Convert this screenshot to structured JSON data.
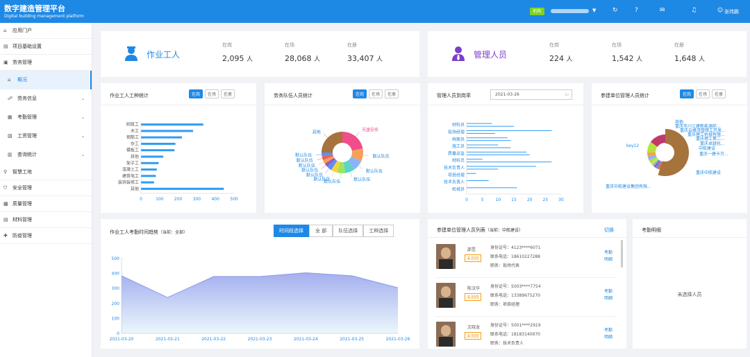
{
  "header": {
    "title": "数字建造管理平台",
    "subtitle": "Digital building management platform",
    "tag": "机构",
    "user": "张伟鹏",
    "icons": [
      "refresh-icon",
      "help-icon",
      "mail-icon",
      "bell-icon",
      "user-icon"
    ]
  },
  "sidebar": {
    "items": [
      {
        "label": "应用门户",
        "icon": "home-icon"
      },
      {
        "label": "项目基础设置",
        "icon": "settings-icon"
      },
      {
        "label": "劳务管理",
        "icon": "folder-icon"
      },
      {
        "label": "概况",
        "icon": "home-icon",
        "sub": true,
        "active": true
      },
      {
        "label": "劳务信息",
        "icon": "people-icon",
        "sub": true,
        "arrow": true
      },
      {
        "label": "考勤管理",
        "icon": "calendar-icon",
        "sub": true,
        "arrow": true
      },
      {
        "label": "工资管理",
        "icon": "wallet-icon",
        "sub": true,
        "arrow": true
      },
      {
        "label": "查询统计",
        "icon": "chart-icon",
        "sub": true,
        "arrow": true
      },
      {
        "label": "智慧工地",
        "icon": "pin-icon"
      },
      {
        "label": "安全管理",
        "icon": "shield-icon"
      },
      {
        "label": "质量管理",
        "icon": "check-icon"
      },
      {
        "label": "材料管理",
        "icon": "box-icon"
      },
      {
        "label": "防疫管理",
        "icon": "medical-icon"
      }
    ]
  },
  "workers": {
    "title": "作业工人",
    "stats": [
      {
        "label": "在岗",
        "value": "2,095",
        "unit": "人"
      },
      {
        "label": "在场",
        "value": "28,068",
        "unit": "人"
      },
      {
        "label": "在册",
        "value": "33,407",
        "unit": "人"
      }
    ]
  },
  "managers": {
    "title": "管理人员",
    "stats": [
      {
        "label": "在岗",
        "value": "224",
        "unit": "人"
      },
      {
        "label": "在场",
        "value": "1,542",
        "unit": "人"
      },
      {
        "label": "在册",
        "value": "1,648",
        "unit": "人"
      }
    ]
  },
  "tabs3": [
    "在岗",
    "在场",
    "在册"
  ],
  "card1": {
    "title": "作业工人工种统计"
  },
  "card2": {
    "title": "劳务队伍人员统计"
  },
  "card3": {
    "title": "管理人员到岗率",
    "date": "2021-03-26"
  },
  "card4": {
    "title": "参建单位管理人员统计"
  },
  "card5": {
    "title": "作业工人考勤时间趋势",
    "current": "（当前：全部）",
    "buttons": [
      "时间段选择",
      "全 部",
      "队伍选择",
      "工种选择"
    ]
  },
  "card6": {
    "title": "参建单位管理人员列表",
    "current": "（当前：中航建设）",
    "switch": "切换"
  },
  "card7": {
    "title": "考勤明细",
    "empty": "未选择人员"
  },
  "persons": [
    {
      "name": "邵昱",
      "badge": "未到岗",
      "id": "身份证号：4123****6071",
      "phone": "联系电话：18610227288",
      "role": "职务：现场代表",
      "link": "考勤明细"
    },
    {
      "name": "陈汉华",
      "badge": "未到岗",
      "id": "身份证号：5003****7754",
      "phone": "联系电话：13389675270",
      "role": "职务：项目经理",
      "link": "考勤明细"
    },
    {
      "name": "文晓龙",
      "badge": "未到岗",
      "id": "身份证号：5001****2919",
      "phone": "联系电话：18183140970",
      "role": "职务：技术负责人",
      "link": "考勤明细"
    }
  ],
  "chart_data": [
    {
      "type": "bar",
      "orientation": "horizontal",
      "categories": [
        "砌筑工",
        "木工",
        "钢筋工",
        "杂工",
        "模板工",
        "其他",
        "架子工",
        "混凝土工",
        "建筑电工",
        "装饰装修工",
        "其他"
      ],
      "values": [
        335,
        280,
        220,
        185,
        180,
        120,
        95,
        85,
        80,
        70,
        445
      ],
      "xlim": [
        0,
        500
      ],
      "xticks": [
        0,
        100,
        200,
        300,
        400,
        500
      ],
      "color": "#2e9cf5"
    },
    {
      "type": "pie",
      "labels": [
        "天建劳务",
        "默认队伍",
        "默认队伍",
        "默认队伍",
        "默认队伍",
        "默认队伍",
        "默认队伍",
        "默认队伍",
        "默认队伍",
        "默认队伍",
        "默认队伍",
        "其他"
      ],
      "values": [
        22,
        10,
        8,
        8,
        6,
        5,
        4,
        3,
        3,
        3,
        3,
        25
      ],
      "colors": [
        "#f04e8b",
        "#f5a05a",
        "#8ab4f8",
        "#5fd3c7",
        "#a0e45b",
        "#f5d33b",
        "#5b8ff9",
        "#9b59b6",
        "#f5a05a",
        "#e86452",
        "#5b8ff9",
        "#a5733b"
      ]
    },
    {
      "type": "bar",
      "orientation": "horizontal",
      "categories": [
        "材料员",
        "现场经理",
        "档案员",
        "施工员",
        "质量总监",
        "材料员",
        "技术负责人",
        "项目经理",
        "技术负责人",
        "机械员"
      ],
      "values": [
        8,
        27,
        13,
        10,
        19,
        5,
        22,
        3,
        7,
        16
      ],
      "secondary": [
        15,
        9,
        14,
        14,
        20,
        27,
        10,
        0,
        0,
        0
      ],
      "xlim": [
        0,
        30
      ],
      "xticks": [
        0,
        5,
        10,
        15,
        20,
        25,
        30
      ],
      "color": "#2e9cf5"
    },
    {
      "type": "pie",
      "labels": [
        "key12",
        "其他",
        "重庆市川三建新能源前...",
        "重庆云峰茂管顺工开发...",
        "重庆理工机械有限...",
        "重庆理工第二...",
        "重庆卓越化...",
        "中航建设",
        "重庆一建卡万...",
        "重庆中航建设",
        "重庆中航建设集团有限..."
      ],
      "values": [
        55,
        2,
        2,
        2,
        2,
        2,
        3,
        3,
        4,
        10,
        15
      ],
      "colors": [
        "#a5733b",
        "#e86452",
        "#5b8ff9",
        "#9b59b6",
        "#5fd3c7",
        "#f5d33b",
        "#a0e45b",
        "#8ab4f8",
        "#f5a05a",
        "#b5e23d",
        "#c0396b"
      ]
    },
    {
      "type": "area",
      "x": [
        "2021-03-20",
        "2021-03-21",
        "2021-03-22",
        "2021-03-23",
        "2021-03-24",
        "2021-03-25",
        "2021-03-26"
      ],
      "values": [
        385,
        240,
        380,
        380,
        405,
        385,
        305
      ],
      "ylim": [
        0,
        500
      ],
      "yticks": [
        0,
        100,
        200,
        300,
        400,
        500
      ],
      "color": "#8a9ae6"
    }
  ]
}
